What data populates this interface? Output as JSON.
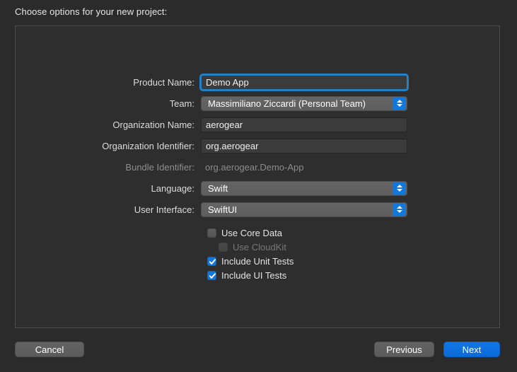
{
  "sheet": {
    "heading": "Choose options for your new project:"
  },
  "form": {
    "rows": [
      {
        "label": "Product Name:",
        "control": "textfield",
        "value": "Demo App",
        "focused": true,
        "name": "product-name"
      },
      {
        "label": "Team:",
        "control": "popup",
        "value": "Massimiliano Ziccardi (Personal Team)",
        "name": "team"
      },
      {
        "label": "Organization Name:",
        "control": "textfield",
        "value": "aerogear",
        "focused": false,
        "name": "organization-name"
      },
      {
        "label": "Organization Identifier:",
        "control": "textfield",
        "value": "org.aerogear",
        "focused": false,
        "name": "organization-identifier"
      },
      {
        "label": "Bundle Identifier:",
        "control": "static",
        "value": "org.aerogear.Demo-App",
        "disabled": true,
        "name": "bundle-identifier"
      },
      {
        "label": "Language:",
        "control": "popup",
        "value": "Swift",
        "name": "language"
      },
      {
        "label": "User Interface:",
        "control": "popup",
        "value": "SwiftUI",
        "name": "user-interface"
      }
    ]
  },
  "checkboxes": [
    {
      "label": "Use Core Data",
      "checked": false,
      "disabled": false,
      "indented": false,
      "name": "use-core-data"
    },
    {
      "label": "Use CloudKit",
      "checked": false,
      "disabled": true,
      "indented": true,
      "name": "use-cloudkit"
    },
    {
      "label": "Include Unit Tests",
      "checked": true,
      "disabled": false,
      "indented": false,
      "name": "include-unit-tests"
    },
    {
      "label": "Include UI Tests",
      "checked": true,
      "disabled": false,
      "indented": false,
      "name": "include-ui-tests"
    }
  ],
  "footer": {
    "cancel_label": "Cancel",
    "previous_label": "Previous",
    "next_label": "Next"
  },
  "colors": {
    "window_background": "#2B2B2B",
    "panel_background": "#2E2E2E",
    "panel_border": "#4A4A4A",
    "accent_blue": "#1278DC",
    "default_button_blue": "#0A6BD8",
    "focus_ring": "#2681C4",
    "field_background": "#3B3B3B",
    "label_text": "#DCDCDC",
    "disabled_text": "#8B8B8B"
  }
}
